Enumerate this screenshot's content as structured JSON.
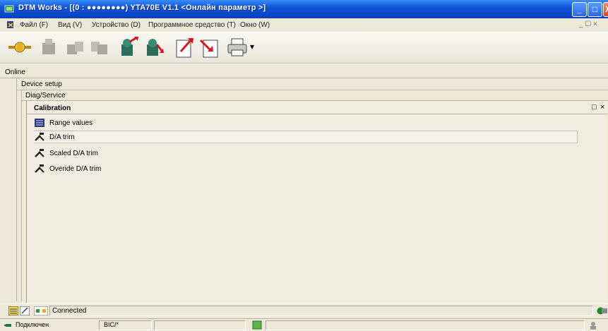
{
  "window": {
    "title": "DTM Works - [(0 : ●●●●●●●●) YTA70E V1.1 <Онлайн параметр >]",
    "controls": {
      "minimize": "_",
      "maximize": "□",
      "close": "X"
    }
  },
  "menu": {
    "items": [
      "Файл (F)",
      "Вид (V)",
      "Устройство (D)",
      "Программное средство (T)",
      "Окно (W)"
    ],
    "mdi_controls": "_ ☐ ×"
  },
  "toolbar": {
    "icons": [
      "connect-icon",
      "device-icon-disabled",
      "upload-icon-disabled",
      "download-icon-disabled",
      "device-online-icon",
      "device-offline-icon",
      "export-icon",
      "import-icon",
      "print-icon"
    ],
    "print_dropdown": "▾"
  },
  "tree": {
    "level1": "Online",
    "level2": "Device setup",
    "level3": "Diag/Service"
  },
  "panel": {
    "title": "Calibration",
    "controls": {
      "restore": "□",
      "close": "×"
    },
    "items": [
      {
        "label": "Range values",
        "icon": "table-icon",
        "selected": false
      },
      {
        "label": "D/A trim",
        "icon": "tools-icon",
        "selected": true
      },
      {
        "label": "Scaled D/A trim",
        "icon": "tools-icon",
        "selected": false
      },
      {
        "label": "Overide D/A trim",
        "icon": "tools-icon",
        "selected": false
      }
    ]
  },
  "status_bar": {
    "connection": "Connected",
    "help": "?"
  },
  "app_status_bar": {
    "connection": "Подключен",
    "protocol": "BIC/*"
  },
  "colors": {
    "title_bar": "#0a45c8",
    "window_bg": "#ece9d8",
    "panel_bg": "#efece0"
  }
}
